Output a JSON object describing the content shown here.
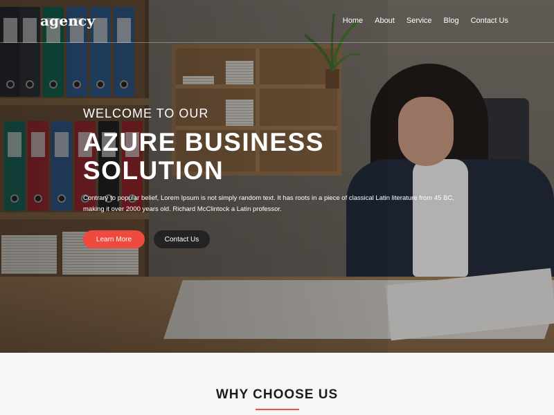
{
  "brand": {
    "logo_text": "agency"
  },
  "nav": {
    "items": [
      {
        "label": "Home"
      },
      {
        "label": "About"
      },
      {
        "label": "Service"
      },
      {
        "label": "Blog"
      },
      {
        "label": "Contact Us"
      }
    ]
  },
  "hero": {
    "welcome": "WELCOME TO OUR",
    "headline_line1": "AZURE BUSINESS",
    "headline_line2": "SOLUTION",
    "intro": "Contrary to popular belief, Lorem Ipsum is not simply random text. It has roots in a piece of classical Latin literature from 45 BC, making it over 2000 years old. Richard McClintock  a Latin professor.",
    "learn_more_label": "Learn More",
    "contact_label": "Contact Us",
    "background_image": "office-woman-reviewing-documents-photo"
  },
  "why": {
    "title": "WHY CHOOSE US"
  },
  "colors": {
    "accent": "#f04a3e",
    "dark_button": "#232323",
    "section_bg": "#f6f6f6",
    "text_dark": "#1c1c1c"
  }
}
